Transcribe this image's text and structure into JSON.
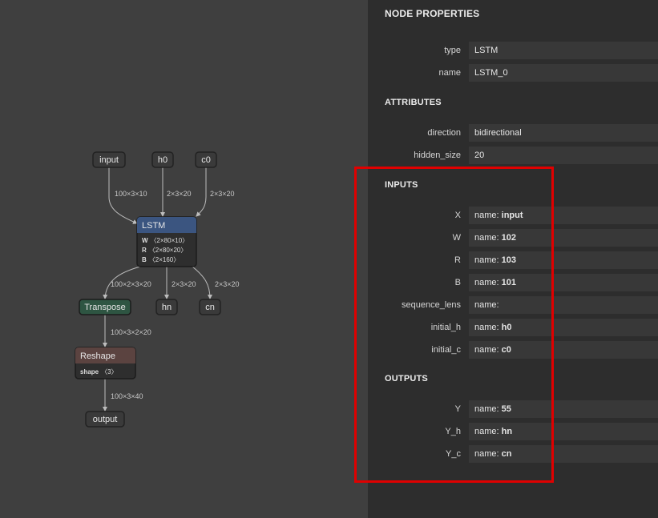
{
  "graph": {
    "nodes": {
      "input": "input",
      "h0": "h0",
      "c0": "c0",
      "lstm": "LSTM",
      "transpose": "Transpose",
      "hn": "hn",
      "cn": "cn",
      "reshape": "Reshape",
      "output": "output"
    },
    "lstm_attrs": [
      {
        "key": "W",
        "value": "〈2×80×10〉"
      },
      {
        "key": "R",
        "value": "〈2×80×20〉"
      },
      {
        "key": "B",
        "value": "〈2×160〉"
      }
    ],
    "reshape_attrs": [
      {
        "key": "shape",
        "value": "〈3〉"
      }
    ],
    "edges": {
      "input_lstm": "100×3×10",
      "h0_lstm": "2×3×20",
      "c0_lstm": "2×3×20",
      "lstm_transpose": "100×2×3×20",
      "lstm_hn": "2×3×20",
      "lstm_cn": "2×3×20",
      "transpose_reshape": "100×3×2×20",
      "reshape_output": "100×3×40"
    },
    "colors": {
      "lstm_header": "#3b5580",
      "transpose": "#2e5542",
      "reshape_header": "#5b4340",
      "node_fill": "#3a3a3a",
      "node_stroke": "#222222"
    }
  },
  "panel": {
    "title": "NODE PROPERTIES",
    "properties": [
      {
        "label": "type",
        "value": "LSTM"
      },
      {
        "label": "name",
        "value": "LSTM_0"
      }
    ],
    "attributes_title": "ATTRIBUTES",
    "attributes": [
      {
        "label": "direction",
        "value": "bidirectional"
      },
      {
        "label": "hidden_size",
        "value": "20"
      }
    ],
    "inputs_title": "INPUTS",
    "inputs": [
      {
        "label": "X",
        "prefix": "name: ",
        "value": "input"
      },
      {
        "label": "W",
        "prefix": "name: ",
        "value": "102"
      },
      {
        "label": "R",
        "prefix": "name: ",
        "value": "103"
      },
      {
        "label": "B",
        "prefix": "name: ",
        "value": "101"
      },
      {
        "label": "sequence_lens",
        "prefix": "name: ",
        "value": ""
      },
      {
        "label": "initial_h",
        "prefix": "name: ",
        "value": "h0"
      },
      {
        "label": "initial_c",
        "prefix": "name: ",
        "value": "c0"
      }
    ],
    "outputs_title": "OUTPUTS",
    "outputs": [
      {
        "label": "Y",
        "prefix": "name: ",
        "value": "55"
      },
      {
        "label": "Y_h",
        "prefix": "name: ",
        "value": "hn"
      },
      {
        "label": "Y_c",
        "prefix": "name: ",
        "value": "cn"
      }
    ],
    "highlight_color": "#e00000"
  }
}
